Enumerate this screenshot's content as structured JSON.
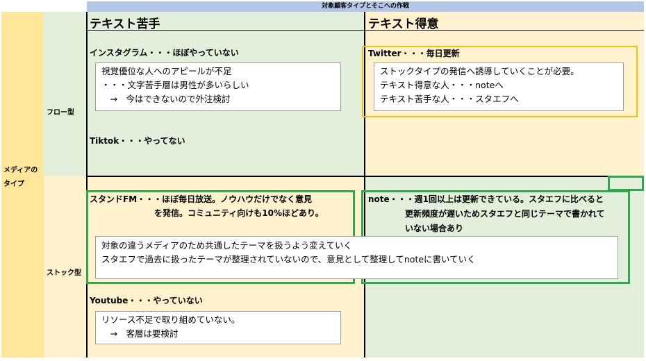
{
  "header": {
    "title": "対象顧客タイプとそこへの作戦"
  },
  "columns": {
    "text_weak": "テキスト苦手",
    "text_strong": "テキスト得意"
  },
  "rows": {
    "media_type": "メディアのタイプ",
    "flow": "フロー型",
    "stock": "ストック型"
  },
  "cells": {
    "flow_weak": {
      "instagram": "インスタグラム・・・ほぼやっていない",
      "instagram_notes": [
        "視覚優位な人へのアピールが不足",
        "・・・文字苦手層は男性が多いらしい",
        "　→　今はできないので外注検討"
      ],
      "tiktok": "Tiktok・・・やってない"
    },
    "flow_strong": {
      "twitter": "Twitter・・・毎日更新",
      "twitter_notes": [
        "ストックタイプの発信へ誘導していくことが必要。",
        "テキスト得意な人・・・noteへ",
        "テキスト苦手な人・・・スタエフへ"
      ]
    },
    "stock_weak": {
      "standfm_line1": "スタンドFM・・・ほぼ毎日放送。ノウハウだけでなく意見",
      "standfm_line2": "を発信。コミュニティ向けも10%ほどあり。",
      "youtube": "Youtube・・・やっていない",
      "youtube_notes": [
        "リソース不足で取り組めていない。",
        "　→　客層は要検討"
      ]
    },
    "stock_strong": {
      "note_line1": "note・・・週1回以上は更新できている。スタエフに比べると",
      "note_line2": "更新頻度が遅いためスタエフと同じテーマで書かれて",
      "note_line3": "いない場合あり"
    },
    "shared_notes": [
      "対象の違うメディアのため共通したテーマを扱うよう変えていく",
      "スタエフで過去に扱ったテーマが整理されていないので、意見として整理してnoteに書いていく"
    ]
  },
  "colors": {
    "header": "#b4c6e7",
    "green_cell": "#e2efda",
    "yellow_cell": "#fff2cc",
    "media_col": "#ffe699",
    "gold_frame": "#f3bf12",
    "green_frame": "#2ea84c"
  }
}
